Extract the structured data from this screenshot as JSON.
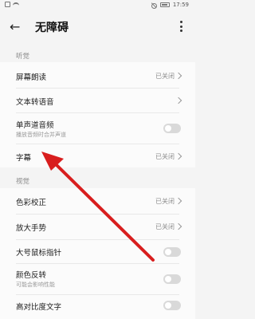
{
  "statusbar": {
    "time": "17:59"
  },
  "header": {
    "title": "无障碍"
  },
  "sections": {
    "listen": "听觉",
    "vision": "视觉"
  },
  "rows": {
    "screen_reader": {
      "title": "屏幕朗读",
      "status": "已关闭"
    },
    "tts": {
      "title": "文本转语音"
    },
    "mono_audio": {
      "title": "单声道音频",
      "subtitle": "播放音频时合并声道",
      "enabled": false
    },
    "captions": {
      "title": "字幕",
      "status": "已关闭"
    },
    "color_correction": {
      "title": "色彩校正",
      "status": "已关闭"
    },
    "magnification": {
      "title": "放大手势",
      "status": "已关闭"
    },
    "large_pointer": {
      "title": "大号鼠标指针",
      "enabled": false
    },
    "color_inversion": {
      "title": "颜色反转",
      "subtitle": "可能会影响性能",
      "enabled": false
    },
    "high_contrast": {
      "title": "高对比度文字",
      "enabled": false
    }
  },
  "annotation": {
    "arrow_color": "#d81e1e"
  }
}
